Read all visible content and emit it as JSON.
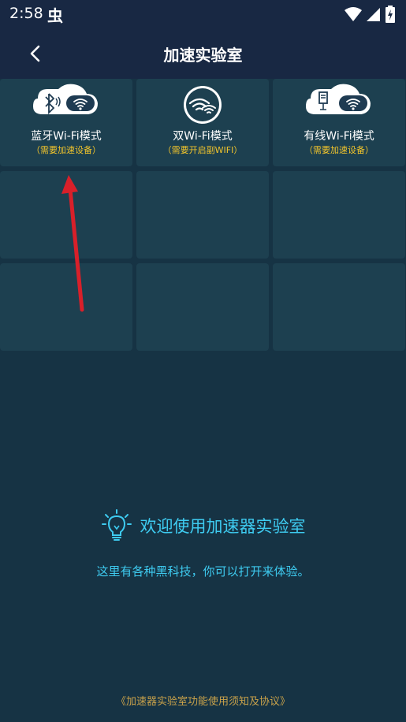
{
  "status_bar": {
    "time": "2:58",
    "notification_glyph": "虫",
    "icons": [
      "wifi-icon",
      "cellular-signal-icon",
      "battery-charging-icon"
    ]
  },
  "app_bar": {
    "title": "加速实验室",
    "back_icon": "chevron-left-icon"
  },
  "modes": [
    {
      "label": "蓝牙Wi-Fi模式",
      "sub": "（需要加速设备）",
      "icon": "bluetooth-wifi-icon"
    },
    {
      "label": "双Wi-Fi模式",
      "sub": "（需要开启副WIFI）",
      "icon": "dual-wifi-icon"
    },
    {
      "label": "有线Wi-Fi模式",
      "sub": "（需要加速设备）",
      "icon": "wired-wifi-icon"
    }
  ],
  "welcome": {
    "icon": "lightbulb-icon",
    "title": "欢迎使用加速器实验室",
    "subtitle": "这里有各种黑科技，你可以打开来体验。"
  },
  "footer": {
    "agreement_link": "《加速器实验室功能使用须知及协议》"
  },
  "colors": {
    "background": "#163344",
    "header": "#182843",
    "tile": "#1d4050",
    "accent": "#3ecbf0",
    "subtitle_yellow": "#f3c52b",
    "footer_gold": "#c9a24a",
    "arrow_red": "#d8202a"
  }
}
